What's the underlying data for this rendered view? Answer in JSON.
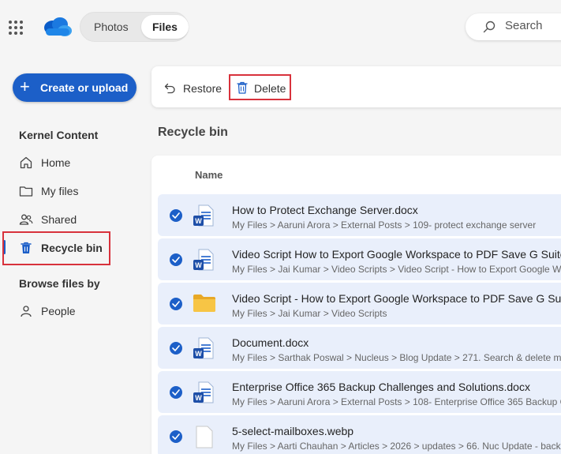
{
  "header": {
    "tabs": [
      {
        "label": "Photos"
      },
      {
        "label": "Files"
      }
    ],
    "search_placeholder": "Search"
  },
  "sidebar": {
    "create_label": "Create or upload",
    "section_title": "Kernel Content",
    "items": [
      {
        "label": "Home",
        "icon": "home-icon"
      },
      {
        "label": "My files",
        "icon": "folder-icon"
      },
      {
        "label": "Shared",
        "icon": "people-icon"
      },
      {
        "label": "Recycle bin",
        "icon": "trash-icon",
        "active": true
      }
    ],
    "browse_title": "Browse files by",
    "browse_items": [
      {
        "label": "People",
        "icon": "person-icon"
      }
    ]
  },
  "commandbar": {
    "restore_label": "Restore",
    "delete_label": "Delete"
  },
  "main": {
    "title": "Recycle bin",
    "column_name": "Name",
    "rows": [
      {
        "name": "How to Protect Exchange Server.docx",
        "path": "My Files > Aaruni Arora > External Posts > 109- protect exchange server",
        "type": "word",
        "selected": true
      },
      {
        "name": "Video Script How to Export Google Workspace to PDF Save G Suite",
        "path": "My Files > Jai Kumar > Video Scripts > Video Script - How to Export Google W",
        "type": "word",
        "selected": true
      },
      {
        "name": "Video Script - How to Export Google Workspace to PDF Save G Suit",
        "path": "My Files > Jai Kumar > Video Scripts",
        "type": "folder",
        "selected": true
      },
      {
        "name": "Document.docx",
        "path": "My Files > Sarthak Poswal > Nucleus > Blog Update > 271. Search & delete m",
        "type": "word",
        "selected": true
      },
      {
        "name": "Enterprise Office 365 Backup Challenges and Solutions.docx",
        "path": "My Files > Aaruni Arora > External Posts > 108- Enterprise Office 365 Backup C",
        "type": "word",
        "selected": true
      },
      {
        "name": "5-select-mailboxes.webp",
        "path": "My Files > Aarti Chauhan > Articles > 2026 > updates > 66. Nuc Update - back",
        "type": "image",
        "selected": true
      }
    ]
  },
  "colors": {
    "accent": "#1c5fc8",
    "selected_row": "#e9effb",
    "highlight_box": "#d8323c"
  }
}
